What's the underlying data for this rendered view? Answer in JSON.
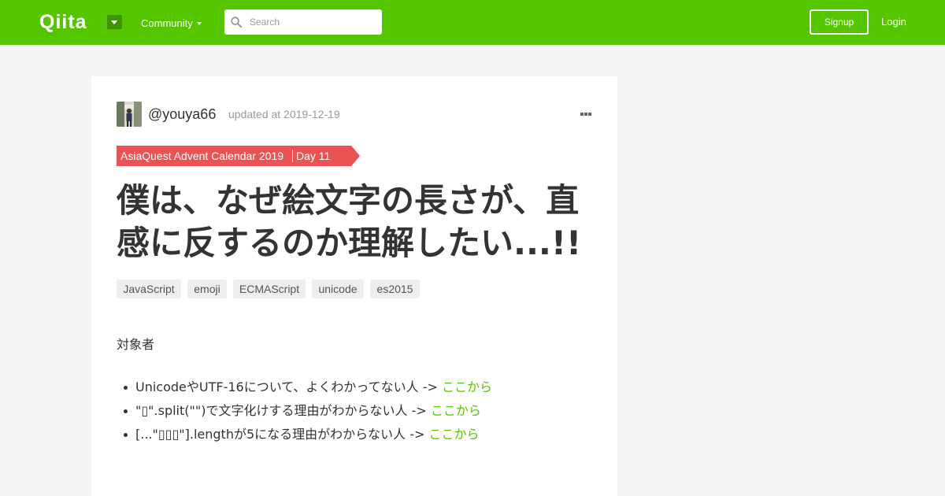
{
  "header": {
    "logo_text": "Qiita",
    "community_label": "Community",
    "search": {
      "placeholder": "Search",
      "value": ""
    },
    "signup_label": "Signup",
    "login_label": "Login"
  },
  "article": {
    "author": "@youya66",
    "updated": "updated at 2019-12-19",
    "calendar": {
      "name": "AsiaQuest Advent Calendar 2019",
      "day": "Day 11"
    },
    "title": "僕は、なぜ絵文字の長さが、直感に反するのか理解したい...!!",
    "tags": [
      "JavaScript",
      "emoji",
      "ECMAScript",
      "unicode",
      "es2015"
    ],
    "section_label": "対象者",
    "audience": [
      {
        "text": "UnicodeやUTF-16について、よくわかってない人 -> ",
        "link": "ここから"
      },
      {
        "text": "\"▯\".split(\"\")で文字化けする理由がわからない人 -> ",
        "link": "ここから"
      },
      {
        "text": "[...\"▯▯▯\"].lengthが5になる理由がわからない人 -> ",
        "link": "ここから"
      }
    ]
  },
  "colors": {
    "brand": "#55c500",
    "ribbon": "#e95353",
    "tag_bg": "#eeeeee",
    "page_bg": "#f5f5f4"
  }
}
